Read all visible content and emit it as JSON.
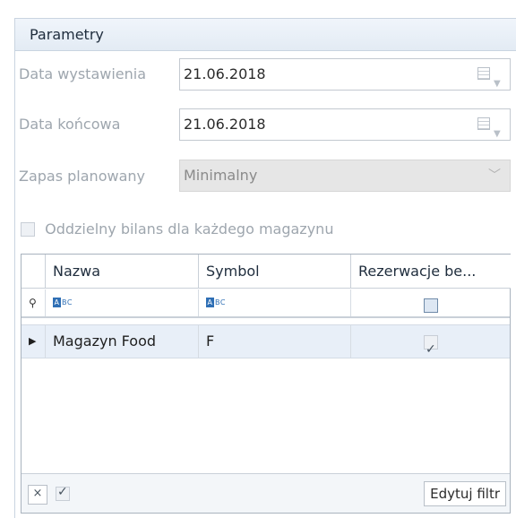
{
  "panel": {
    "title": "Parametry"
  },
  "form": {
    "date_issue": {
      "label": "Data wystawienia",
      "value": "21.06.2018"
    },
    "date_end": {
      "label": "Data końcowa",
      "value": "21.06.2018"
    },
    "stock": {
      "label": "Zapas planowany",
      "value": "Minimalny"
    },
    "separate_balance": {
      "label": "Oddzielny bilans dla każdego magazynu",
      "checked": false
    }
  },
  "grid": {
    "columns": [
      "Nazwa",
      "Symbol",
      "Rezerwacje be..."
    ],
    "filter_placeholders": [
      "ABC",
      "ABC"
    ],
    "rows": [
      {
        "name": "Magazyn Food",
        "symbol": "F",
        "reservations": true
      }
    ]
  },
  "footer": {
    "edit_filter_label": "Edytuj filtr",
    "clear_label": "×",
    "active_checked": true
  },
  "icons": {
    "calendar": "calendar-icon",
    "dropdown": "chevron-down-icon",
    "filter": "filter-pin-icon",
    "row-indicator": "row-pointer-icon"
  },
  "colors": {
    "header_bg": "#e3ebf4",
    "row_highlight": "#e8eff8",
    "accent": "#2f6fb5"
  }
}
